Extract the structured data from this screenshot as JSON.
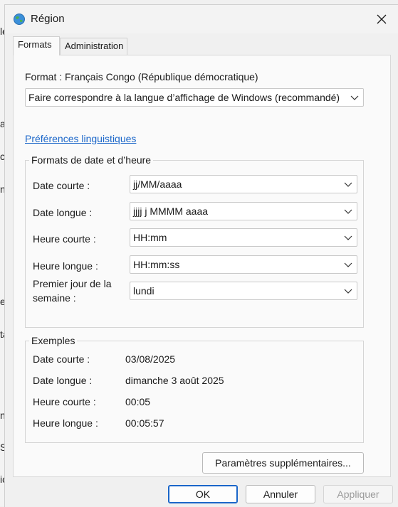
{
  "window": {
    "title": "Région"
  },
  "tabs": [
    {
      "label": "Formats"
    },
    {
      "label": "Administration"
    }
  ],
  "format": {
    "label": "Format : Français Congo (République démocratique)",
    "selected": "Faire correspondre à la langue d’affichage de Windows (recommandé)"
  },
  "links": {
    "language_prefs": "Préférences linguistiques"
  },
  "date_time": {
    "group_title": "Formats de date et d’heure",
    "short_date": {
      "label": "Date courte :",
      "value": "jj/MM/aaaa"
    },
    "long_date": {
      "label": "Date longue :",
      "value": "jjjj j MMMM aaaa"
    },
    "short_time": {
      "label": "Heure courte :",
      "value": "HH:mm"
    },
    "long_time": {
      "label": "Heure longue :",
      "value": "HH:mm:ss"
    },
    "first_day": {
      "label_line1": "Premier jour de la",
      "label_line2": "semaine :",
      "value": "lundi"
    }
  },
  "examples": {
    "group_title": "Exemples",
    "short_date": {
      "label": "Date courte :",
      "value": "03/08/2025"
    },
    "long_date": {
      "label": "Date longue :",
      "value": "dimanche 3 août 2025"
    },
    "short_time": {
      "label": "Heure courte :",
      "value": "00:05"
    },
    "long_time": {
      "label": "Heure longue :",
      "value": "00:05:57"
    }
  },
  "buttons": {
    "more_settings": "Paramètres supplémentaires...",
    "ok": "OK",
    "cancel": "Annuler",
    "apply": "Appliquer"
  },
  "background_fragments": [
    "le",
    "a",
    "c",
    "ne",
    "e",
    "ta",
    "ns",
    "S",
    "ic"
  ],
  "colors": {
    "link": "#1a66c9",
    "accent_border": "#1a66c9",
    "disabled_text": "#9a9a9a"
  }
}
